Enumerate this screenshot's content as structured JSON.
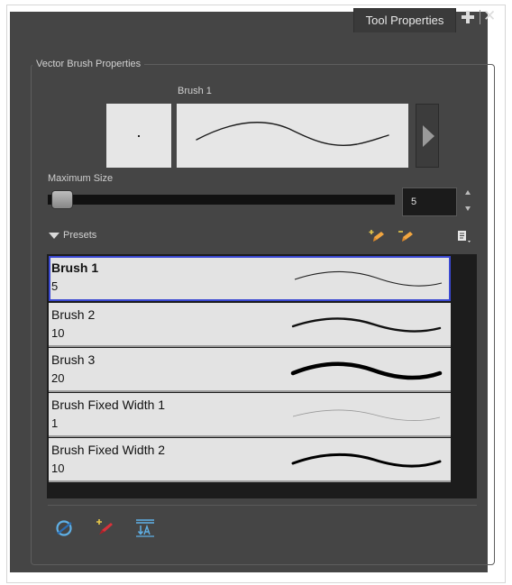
{
  "window": {
    "tab_label": "Tool Properties",
    "group_title": "Vector Brush Properties"
  },
  "preview": {
    "brush_name": "Brush 1"
  },
  "size": {
    "label": "Maximum Size",
    "value": "5",
    "slider_fraction": 0.04
  },
  "presets": {
    "label": "Presets",
    "items": [
      {
        "name": "Brush 1",
        "size": "5",
        "selected": true
      },
      {
        "name": "Brush 2",
        "size": "10",
        "selected": false
      },
      {
        "name": "Brush 3",
        "size": "20",
        "selected": false
      },
      {
        "name": "Brush Fixed Width 1",
        "size": "1",
        "selected": false
      },
      {
        "name": "Brush Fixed Width 2",
        "size": "10",
        "selected": false
      }
    ]
  },
  "icons": {
    "tab": [
      "add-view-icon",
      "close-icon"
    ],
    "preset_toolbar": [
      "new-preset-icon",
      "delete-preset-icon",
      "preset-menu-icon"
    ],
    "bottom_toolbar": [
      "auto-flatten-icon",
      "create-brush-icon",
      "sort-icon"
    ]
  },
  "colors": {
    "panel_bg": "#454545",
    "selection_border": "#3a48d2",
    "list_row_bg": "#e3e3e3"
  }
}
